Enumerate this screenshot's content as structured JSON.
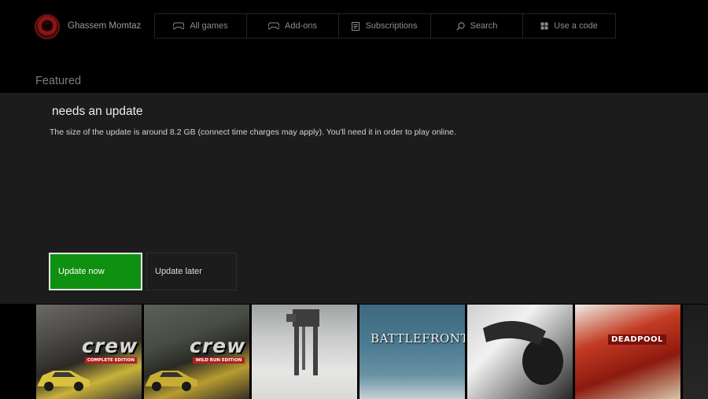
{
  "user": {
    "name": "Ghassem Momtaz"
  },
  "nav": [
    {
      "label": "All games",
      "icon": "gamepad-icon"
    },
    {
      "label": "Add-ons",
      "icon": "gamepad-icon"
    },
    {
      "label": "Subscriptions",
      "icon": "subscription-icon"
    },
    {
      "label": "Search",
      "icon": "search-icon"
    },
    {
      "label": "Use a code",
      "icon": "code-icon"
    }
  ],
  "section": {
    "title": "Featured"
  },
  "dialog": {
    "title": "needs an update",
    "body": "The size of the update is around 8.2 GB (connect time charges may apply). You'll need it in order to play online.",
    "primary_label": "Update now",
    "secondary_label": "Update later"
  },
  "tiles": {
    "crew_logo": "crew",
    "crew_sub_1": "COMPLETE EDITION",
    "crew_sub_2": "WILD RUN EDITION",
    "battlefront_logo": "BATTLEFRONT",
    "deadpool_logo": "DEADPOOL"
  },
  "colors": {
    "accent_green": "#109010",
    "dialog_bg": "#1c1c1c",
    "background": "#000000"
  }
}
